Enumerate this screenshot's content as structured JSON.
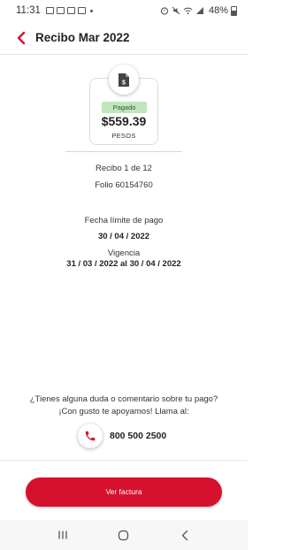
{
  "status_bar": {
    "time": "11:31",
    "battery": "48%"
  },
  "header": {
    "title": "Recibo Mar 2022"
  },
  "receipt": {
    "status": "Pagado",
    "amount": "$559.39",
    "currency": "PESOS",
    "receipt_number": "Recibo 1 de 12",
    "folio": "Folio 60154760",
    "due_date_label": "Fecha límite de pago",
    "due_date": "30 / 04 / 2022",
    "validity_label": "Vigencia",
    "validity": "31 / 03 / 2022 al 30 / 04 / 2022"
  },
  "help": {
    "line1": "¿Tienes alguna duda o comentario sobre tu pago?",
    "line2": "¡Con gusto te apoyamos! Llama al:",
    "phone": "800 500 2500"
  },
  "cta": {
    "label": "Ver factura"
  },
  "colors": {
    "accent": "#d6112d",
    "paid_badge_bg": "#bfe6bf"
  },
  "icons": [
    "back-arrow-icon",
    "document-dollar-icon",
    "phone-icon",
    "recents-icon",
    "home-icon",
    "nav-back-icon"
  ]
}
